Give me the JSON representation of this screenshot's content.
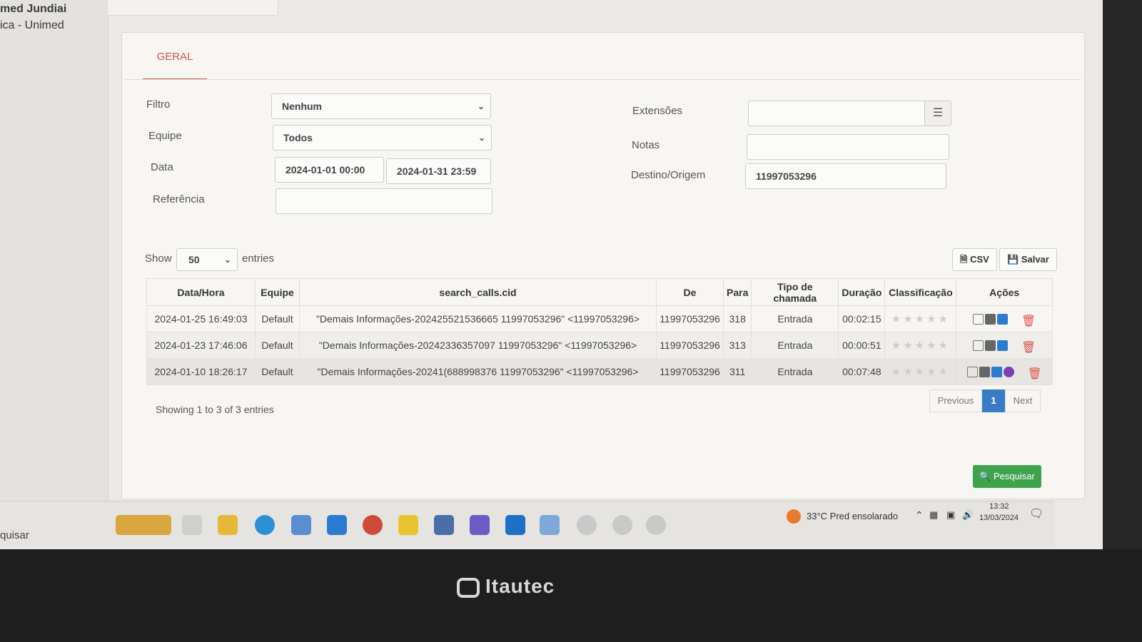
{
  "sidebar": {
    "user": "med Jundiai",
    "org": "ica - Unimed",
    "search_text": "quisar"
  },
  "tabs": [
    {
      "label": "GERAL"
    }
  ],
  "form": {
    "filtro": {
      "label": "Filtro",
      "value": "Nenhum"
    },
    "equipe": {
      "label": "Equipe",
      "value": "Todos"
    },
    "data": {
      "label": "Data",
      "start": "2024-01-01 00:00",
      "end": "2024-01-31 23:59"
    },
    "referencia": {
      "label": "Referência",
      "value": ""
    },
    "extensoes": {
      "label": "Extensões",
      "value": ""
    },
    "notas": {
      "label": "Notas",
      "value": ""
    },
    "destino": {
      "label": "Destino/Origem",
      "value": "11997053296"
    }
  },
  "table_controls": {
    "show_label": "Show",
    "entries_value": "50",
    "entries_label": "entries",
    "csv_label": "CSV",
    "salvar_label": "Salvar"
  },
  "table": {
    "headers": [
      "Data/Hora",
      "Equipe",
      "search_calls.cid",
      "De",
      "Para",
      "Tipo de chamada",
      "Duração",
      "Classificação",
      "Ações"
    ],
    "rows": [
      {
        "datetime": "2024-01-25 16:49:03",
        "equipe": "Default",
        "cid": "\"Demais Informações-202425521536665 11997053296\" <11997053296>",
        "de": "11997053296",
        "para": "318",
        "tipo": "Entrada",
        "duracao": "00:02:15",
        "rating": 0
      },
      {
        "datetime": "2024-01-23 17:46:06",
        "equipe": "Default",
        "cid": "\"Demais Informações-20242336357097 11997053296\" <11997053296>",
        "de": "11997053296",
        "para": "313",
        "tipo": "Entrada",
        "duracao": "00:00:51",
        "rating": 0
      },
      {
        "datetime": "2024-01-10 18:26:17",
        "equipe": "Default",
        "cid": "\"Demais Informações-20241(688998376 11997053296\" <11997053296>",
        "de": "11997053296",
        "para": "311",
        "tipo": "Entrada",
        "duracao": "00:07:48",
        "rating": 0
      }
    ]
  },
  "footer": {
    "info": "Showing 1 to 3 of 3 entries",
    "previous": "Previous",
    "page": "1",
    "next": "Next",
    "search_button": "Pesquisar"
  },
  "taskbar": {
    "weather": "33°C  Pred ensolarado",
    "time": "13:32",
    "date": "13/03/2024"
  },
  "monitor": {
    "brand": "Itautec"
  },
  "colors": {
    "accent": "#d9534f",
    "primary": "#3a7cc4",
    "success": "#3fa34d"
  }
}
